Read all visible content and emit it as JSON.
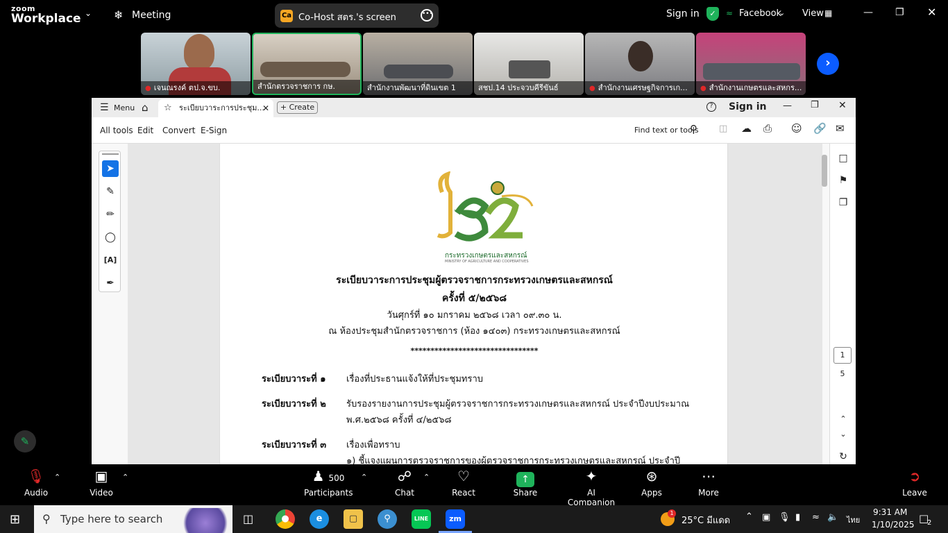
{
  "zoom": {
    "logo_small": "zoom",
    "logo_big": "Workplace",
    "meeting_label": "Meeting",
    "share_banner": {
      "badge": "Ca",
      "text": "Co-Host สตร.'s screen"
    },
    "sign_in": "Sign in",
    "facebook": "Facebook",
    "view": "View"
  },
  "participants": [
    {
      "name": "เจนณรงค์ ตป.จ.ขบ."
    },
    {
      "name": "สำนักตรวจราชการ กษ."
    },
    {
      "name": "สำนักงานพัฒนาที่ดินเขต 1"
    },
    {
      "name": "สชป.14 ประจวบคีรีขันธ์"
    },
    {
      "name": "สำนักงานเศรษฐกิจการเก..."
    },
    {
      "name": "สำนักงานเกษตรและสหกร..."
    }
  ],
  "acrobat": {
    "menu_label": "Menu",
    "tab_title": "ระเบียบวาระการประชุม...",
    "create_label": "Create",
    "sign_in": "Sign in",
    "menus": [
      "All tools",
      "Edit",
      "Convert",
      "E-Sign"
    ],
    "find_placeholder": "Find text or tools",
    "page_current": "1",
    "page_total": "5"
  },
  "document": {
    "logo_text": "กระทรวงเกษตรและสหกรณ์",
    "logo_subtext": "MINISTRY OF AGRICULTURE AND COOPERATIVES",
    "title": "ระเบียบวาระการประชุมผู้ตรวจราชการกระทรวงเกษตรและสหกรณ์",
    "session": "ครั้งที่ ๕/๒๕๖๘",
    "date": "วันศุกร์ที่ ๑๐ มกราคม ๒๕๖๘ เวลา ๐๙.๓๐ น.",
    "venue": "ณ ห้องประชุมสำนักตรวจราชการ (ห้อง ๑๔๐๓) กระทรวงเกษตรและสหกรณ์",
    "divider": "********************************",
    "agenda": [
      {
        "label": "ระเบียบวาระที่ ๑",
        "text": "เรื่องที่ประธานแจ้งให้ที่ประชุมทราบ"
      },
      {
        "label": "ระเบียบวาระที่ ๒",
        "text": "รับรองรายงานการประชุมผู้ตรวจราชการกระทรวงเกษตรและสหกรณ์ ประจำปีงบประมาณ",
        "text2": "พ.ศ.๒๕๖๘ ครั้งที่ ๔/๒๕๖๘"
      },
      {
        "label": "ระเบียบวาระที่ ๓",
        "text": "เรื่องเพื่อทราบ",
        "text2": "๑) ชี้แจงแผนการตรวจราชการของผู้ตรวจราชการกระทรวงเกษตรและสหกรณ์ ประจำปี"
      }
    ]
  },
  "controls": {
    "audio": "Audio",
    "video": "Video",
    "participants_count": "500",
    "participants": "Participants",
    "chat": "Chat",
    "react": "React",
    "share": "Share",
    "ai": "AI Companion",
    "apps": "Apps",
    "more": "More",
    "leave": "Leave"
  },
  "taskbar": {
    "search_placeholder": "Type here to search",
    "weather": "25°C มีแดด",
    "weather_badge": "1",
    "lang": "ไทย",
    "time": "9:31 AM",
    "date": "1/10/2025",
    "notif_count": "2"
  }
}
